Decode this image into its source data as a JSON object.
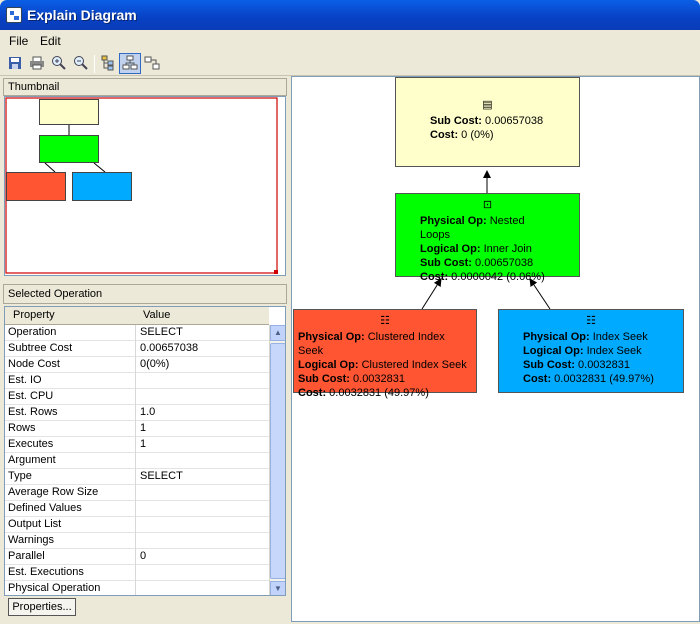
{
  "window": {
    "title": "Explain Diagram"
  },
  "menu": {
    "file": "File",
    "edit": "Edit"
  },
  "toolbar": {
    "icons": [
      "save-icon",
      "print-icon",
      "zoom-in-icon",
      "zoom-out-icon",
      "tree-icon",
      "layout-vertical-icon",
      "layout-horizontal-icon"
    ]
  },
  "thumbnail": {
    "title": "Thumbnail"
  },
  "selected": {
    "title": "Selected Operation",
    "col_property": "Property",
    "col_value": "Value",
    "rows": [
      {
        "p": "Operation",
        "v": "SELECT"
      },
      {
        "p": "Subtree Cost",
        "v": "0.00657038"
      },
      {
        "p": "Node Cost",
        "v": "0(0%)"
      },
      {
        "p": "Est. IO",
        "v": ""
      },
      {
        "p": "Est. CPU",
        "v": ""
      },
      {
        "p": "Est. Rows",
        "v": "1.0"
      },
      {
        "p": "Rows",
        "v": "1"
      },
      {
        "p": "Executes",
        "v": "1"
      },
      {
        "p": "Argument",
        "v": ""
      },
      {
        "p": "Type",
        "v": "SELECT"
      },
      {
        "p": "Average Row Size",
        "v": ""
      },
      {
        "p": "Defined Values",
        "v": ""
      },
      {
        "p": "Output List",
        "v": ""
      },
      {
        "p": "Warnings",
        "v": ""
      },
      {
        "p": "Parallel",
        "v": "0"
      },
      {
        "p": "Est. Executions",
        "v": ""
      },
      {
        "p": "Physical Operation",
        "v": ""
      }
    ]
  },
  "properties_button": "Properties...",
  "diagram": {
    "labels": {
      "physical": "Physical Op:",
      "logical": "Logical Op:",
      "sub": "Sub Cost:",
      "cost": "Cost:"
    },
    "select": {
      "sub_cost": "0.00657038",
      "cost": "0 (0%)",
      "color": "#ffffcc"
    },
    "nested": {
      "physical": "Nested Loops",
      "logical": "Inner Join",
      "sub_cost": "0.00657038",
      "cost": "0.0000042 (0.06%)",
      "color": "#00ff00"
    },
    "clustered": {
      "physical": "Clustered Index Seek",
      "logical": "Clustered Index Seek",
      "sub_cost": "0.0032831",
      "cost": "0.0032831 (49.97%)",
      "color": "#ff5533"
    },
    "seek": {
      "physical": "Index Seek",
      "logical": "Index Seek",
      "sub_cost": "0.0032831",
      "cost": "0.0032831 (49.97%)",
      "color": "#00aaff"
    }
  }
}
